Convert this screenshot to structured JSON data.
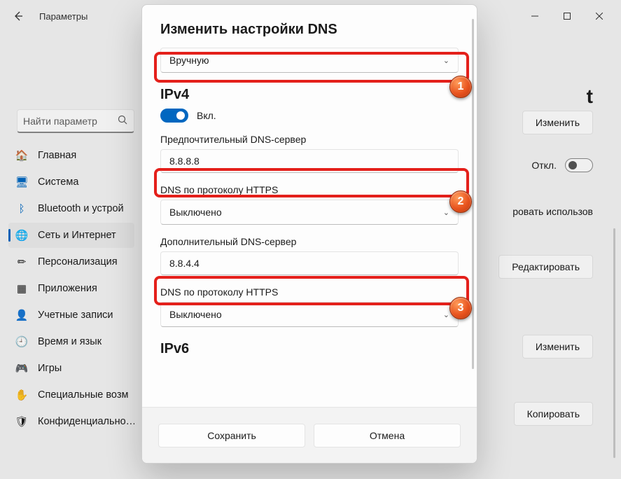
{
  "window": {
    "title": "Параметры",
    "page_title_fragment": "t"
  },
  "search": {
    "placeholder": "Найти параметр"
  },
  "sidebar": {
    "items": [
      {
        "label": "Главная",
        "icon": "🏠"
      },
      {
        "label": "Система",
        "icon": "🖥"
      },
      {
        "label": "Bluetooth и устрой",
        "icon": "ᛒ"
      },
      {
        "label": "Сеть и Интернет",
        "icon": "🌐"
      },
      {
        "label": "Персонализация",
        "icon": "✏"
      },
      {
        "label": "Приложения",
        "icon": "▦"
      },
      {
        "label": "Учетные записи",
        "icon": "👤"
      },
      {
        "label": "Время и язык",
        "icon": "🕘"
      },
      {
        "label": "Игры",
        "icon": "🎮"
      },
      {
        "label": "Специальные возм",
        "icon": "✋"
      },
      {
        "label": "Конфиденциально…",
        "icon": "🛡"
      }
    ],
    "selected_index": 3
  },
  "right_panel": {
    "btn_edit": "Изменить",
    "toggle_off_label": "Откл.",
    "metered_text": "ровать использов",
    "btn_edit2": "Редактировать",
    "btn_edit3": "Изменить",
    "btn_copy": "Копировать"
  },
  "dialog": {
    "title": "Изменить настройки DNS",
    "mode_value": "Вручную",
    "ipv4_heading": "IPv4",
    "ipv4_toggle_label": "Вкл.",
    "preferred_label": "Предпочтительный DNS-сервер",
    "preferred_value": "8.8.8.8",
    "doh_label": "DNS по протоколу HTTPS",
    "doh_value": "Выключено",
    "alternate_label": "Дополнительный DNS-сервер",
    "alternate_value": "8.8.4.4",
    "doh2_label": "DNS по протоколу HTTPS",
    "doh2_value": "Выключено",
    "ipv6_heading": "IPv6",
    "save": "Сохранить",
    "cancel": "Отмена"
  },
  "annotations": {
    "b1": "1",
    "b2": "2",
    "b3": "3"
  }
}
